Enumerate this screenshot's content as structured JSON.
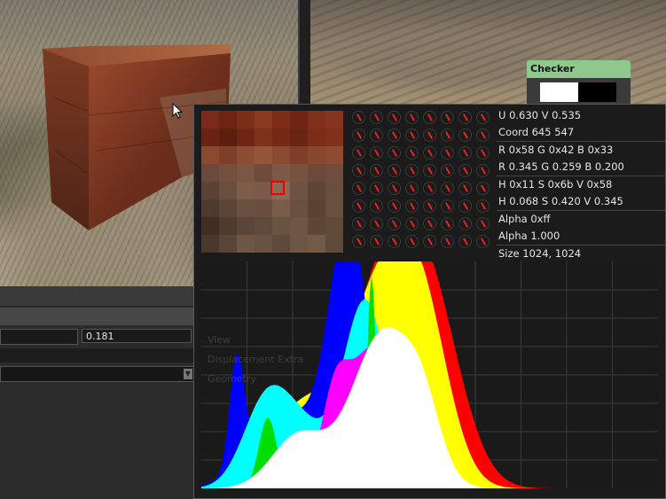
{
  "colors": {
    "checker_title_bg": "#8fc88c",
    "cursor_box": "#ee0000",
    "histogram": {
      "red": "#ff0000",
      "yellow": "#ffff00",
      "blue": "#0000ff",
      "cyan": "#00ffff",
      "magenta": "#ff00ff",
      "green": "#00dd00",
      "white": "#ffffff"
    }
  },
  "checker_node": {
    "title": "Checker"
  },
  "property_panel": {
    "value_field": "0.181",
    "dropdown_arrow_icon": "chevron-down-icon"
  },
  "inspector": {
    "uv": "U 0.630 V 0.535",
    "coord": "Coord 645 547",
    "rgb_hex": "R 0x58  G 0x42  B 0x33",
    "rgb_float": "R 0.345 G 0.259 B 0.200",
    "hsv_hex": "H 0x11  S 0x6b  V 0x58",
    "hsv_float": "H 0.068 S 0.420 V 0.345",
    "alpha_hex": "Alpha 0xff",
    "alpha_float": "Alpha 1.000",
    "size": "Size 1024, 1024",
    "ghost_labels": [
      "View",
      "Displacement Extra",
      "Geometry"
    ]
  }
}
